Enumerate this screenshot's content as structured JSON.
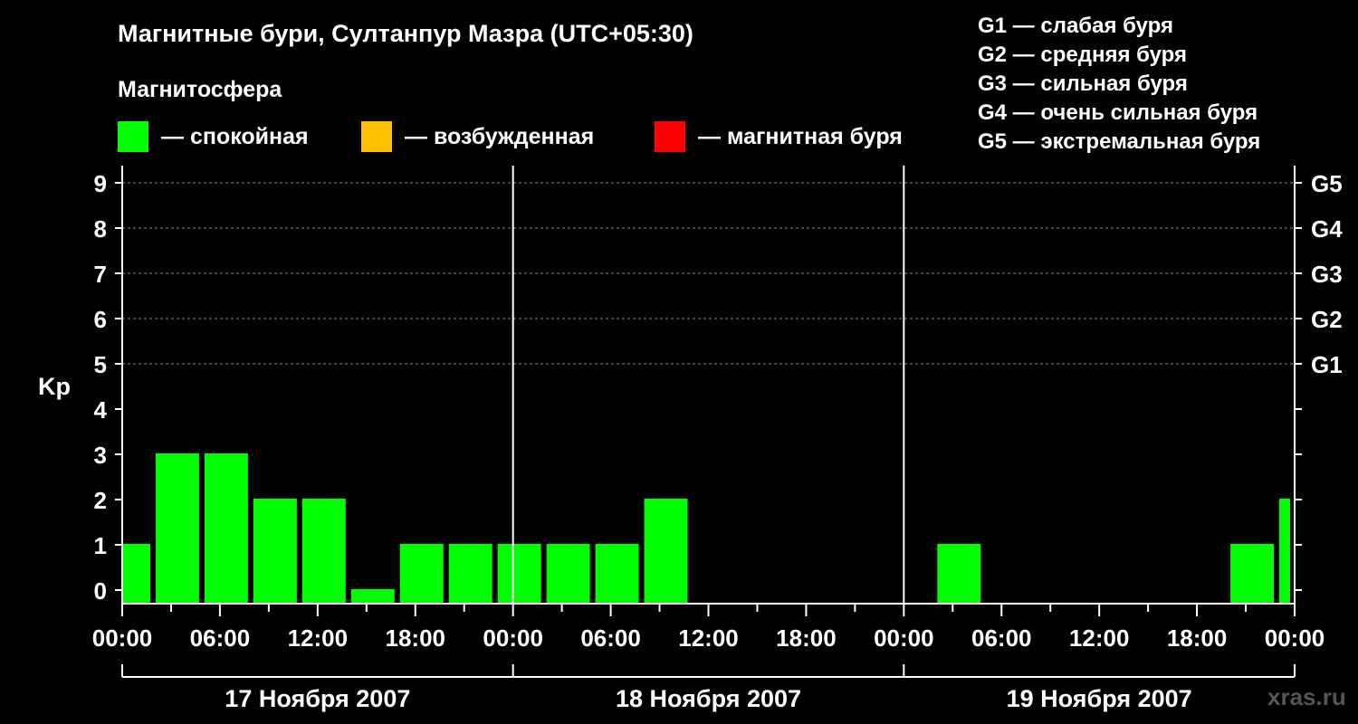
{
  "title": "Магнитные бури, Султанпур Мазра (UTC+05:30)",
  "magnetosphere_title": "Магнитосфера",
  "legend": [
    {
      "label": "— спокойная",
      "color": "#00ff00"
    },
    {
      "label": "— возбужденная",
      "color": "#ffc000"
    },
    {
      "label": "— магнитная буря",
      "color": "#ff0000"
    }
  ],
  "g_scale": [
    "G1 — слабая буря",
    "G2 — средняя буря",
    "G3 — сильная буря",
    "G4 — очень сильная буря",
    "G5 — экстремальная буря"
  ],
  "watermark": "xras.ru",
  "chart_data": {
    "type": "bar",
    "ylabel": "Kp",
    "ylim": [
      0,
      9
    ],
    "y_ticks": [
      "0",
      "1",
      "2",
      "3",
      "4",
      "5",
      "6",
      "7",
      "8",
      "9"
    ],
    "right_axis_labels": [
      {
        "kp": 5,
        "label": "G1"
      },
      {
        "kp": 6,
        "label": "G2"
      },
      {
        "kp": 7,
        "label": "G3"
      },
      {
        "kp": 8,
        "label": "G4"
      },
      {
        "kp": 9,
        "label": "G5"
      }
    ],
    "x_tick_labels": [
      "00:00",
      "06:00",
      "12:00",
      "18:00",
      "00:00",
      "06:00",
      "12:00",
      "18:00",
      "00:00",
      "06:00",
      "12:00",
      "18:00",
      "00:00"
    ],
    "days": [
      "17 Ноября 2007",
      "18 Ноября 2007",
      "19 Ноября 2007"
    ],
    "grid": "dashed at Kp 5-9",
    "series": [
      {
        "color": "#00ff00",
        "bars": [
          {
            "start": "2007-11-17 00:00",
            "end": "2007-11-17 02:00",
            "kp": 1
          },
          {
            "start": "2007-11-17 02:00",
            "end": "2007-11-17 05:00",
            "kp": 3
          },
          {
            "start": "2007-11-17 05:00",
            "end": "2007-11-17 08:00",
            "kp": 3
          },
          {
            "start": "2007-11-17 08:00",
            "end": "2007-11-17 11:00",
            "kp": 2
          },
          {
            "start": "2007-11-17 11:00",
            "end": "2007-11-17 14:00",
            "kp": 2
          },
          {
            "start": "2007-11-17 14:00",
            "end": "2007-11-17 17:00",
            "kp": 0
          },
          {
            "start": "2007-11-17 17:00",
            "end": "2007-11-17 20:00",
            "kp": 1
          },
          {
            "start": "2007-11-17 20:00",
            "end": "2007-11-17 23:00",
            "kp": 1
          },
          {
            "start": "2007-11-17 23:00",
            "end": "2007-11-18 02:00",
            "kp": 1
          },
          {
            "start": "2007-11-18 02:00",
            "end": "2007-11-18 05:00",
            "kp": 1
          },
          {
            "start": "2007-11-18 05:00",
            "end": "2007-11-18 08:00",
            "kp": 1
          },
          {
            "start": "2007-11-18 08:00",
            "end": "2007-11-18 11:00",
            "kp": 2
          },
          {
            "start": "2007-11-19 02:00",
            "end": "2007-11-19 05:00",
            "kp": 1
          },
          {
            "start": "2007-11-19 20:00",
            "end": "2007-11-19 23:00",
            "kp": 1
          },
          {
            "start": "2007-11-19 23:00",
            "end": "2007-11-20 00:00",
            "kp": 2
          }
        ]
      }
    ]
  }
}
